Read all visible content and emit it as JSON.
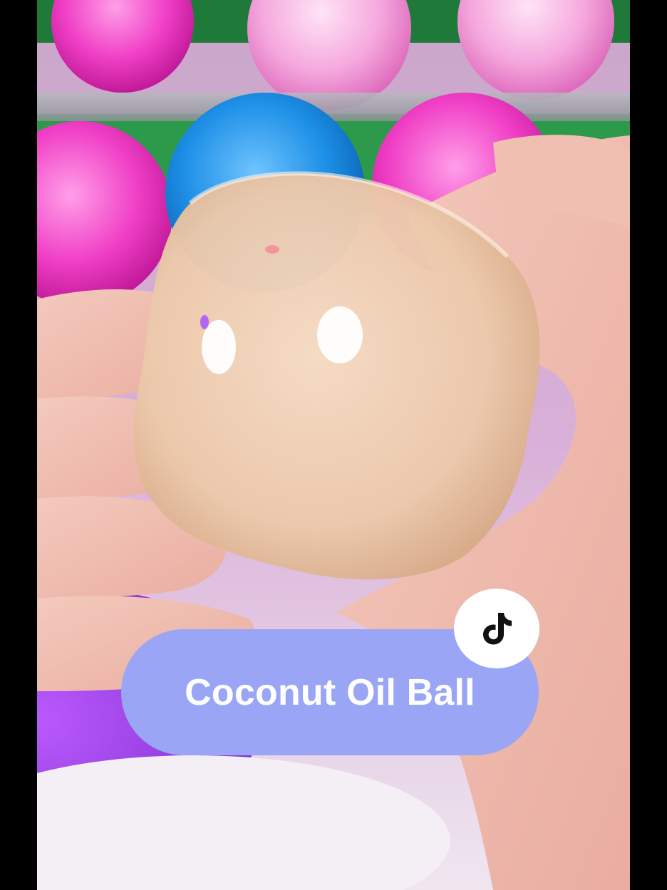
{
  "caption": {
    "text": "Coconut Oil Ball",
    "pill_color": "#9aa6f5",
    "text_color": "#ffffff"
  },
  "logo": {
    "icon": "tiktok-note-icon",
    "badge_color": "#ffffff",
    "glyph_color": "#111111"
  },
  "colors": {
    "letterbox": "#000000"
  }
}
